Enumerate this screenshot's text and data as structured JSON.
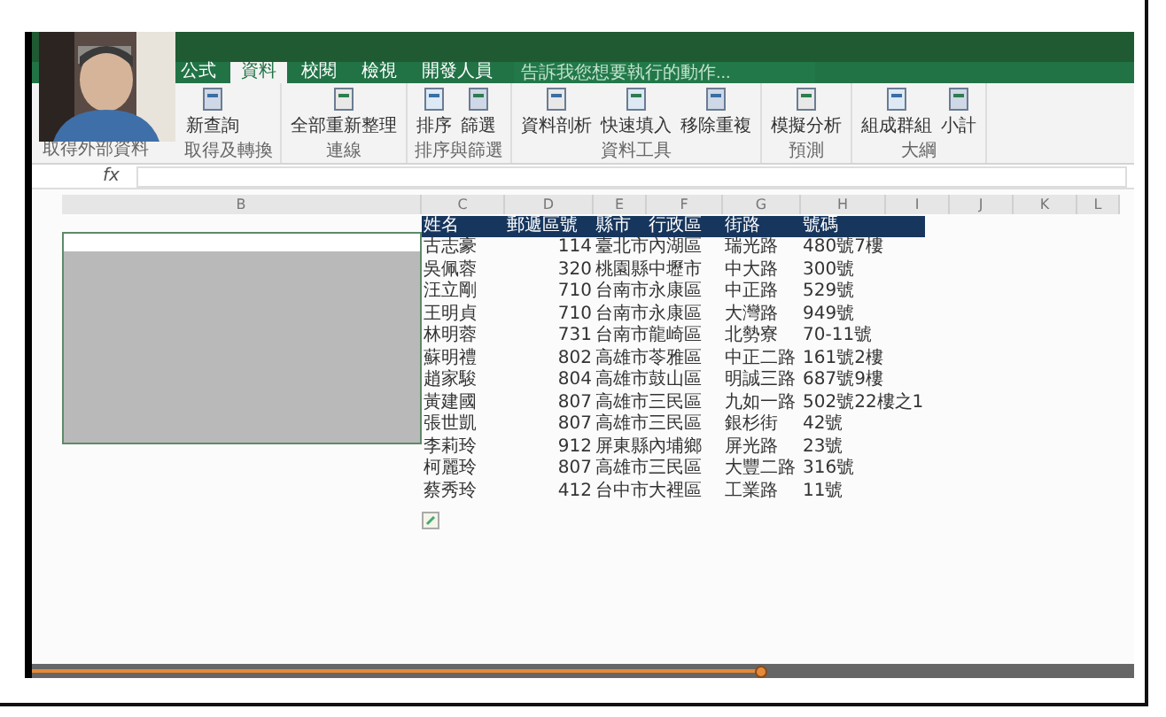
{
  "ribbon_tabs": [
    {
      "label": "公式",
      "selected": false
    },
    {
      "label": "資料",
      "selected": true
    },
    {
      "label": "校閱",
      "selected": false
    },
    {
      "label": "檢視",
      "selected": false
    },
    {
      "label": "開發人員",
      "selected": false
    }
  ],
  "tell_me": {
    "placeholder": "告訴我您想要執行的動作..."
  },
  "first_group": "取得外部資料",
  "ribbon_groups": [
    {
      "label": "取得及轉換",
      "buttons": [
        "新查詢"
      ]
    },
    {
      "label": "連線",
      "buttons": [
        "全部重新整理"
      ]
    },
    {
      "label": "排序與篩選",
      "buttons": [
        "排序",
        "篩選"
      ]
    },
    {
      "label": "資料工具",
      "buttons": [
        "資料剖析",
        "快速填入",
        "移除重複"
      ]
    },
    {
      "label": "預測",
      "buttons": [
        "模擬分析"
      ]
    },
    {
      "label": "大綱",
      "buttons": [
        "組成群組",
        "小計"
      ]
    }
  ],
  "formula_bar": {
    "function_label": "fx"
  },
  "column_letters": [
    "B",
    "C",
    "D",
    "E",
    "F",
    "G",
    "H",
    "I",
    "J",
    "K",
    "L"
  ],
  "table": {
    "columns": [
      "姓名",
      "郵遞區號",
      "縣市",
      "行政區",
      "街路",
      "號碼"
    ],
    "rows": [
      [
        "古志豪",
        "114",
        "臺北市",
        "內湖區",
        "瑞光路",
        "480號7樓"
      ],
      [
        "吳佩蓉",
        "320",
        "桃園縣",
        "中壢市",
        "中大路",
        "300號"
      ],
      [
        "汪立剛",
        "710",
        "台南市",
        "永康區",
        "中正路",
        "529號"
      ],
      [
        "王明貞",
        "710",
        "台南市",
        "永康區",
        "大灣路",
        "949號"
      ],
      [
        "林明蓉",
        "731",
        "台南市",
        "龍崎區",
        "北勢寮",
        "70-11號"
      ],
      [
        "蘇明禮",
        "802",
        "高雄市",
        "苓雅區",
        "中正二路",
        "161號2樓"
      ],
      [
        "趙家駿",
        "804",
        "高雄市",
        "鼓山區",
        "明誠三路",
        "687號9樓"
      ],
      [
        "黃建國",
        "807",
        "高雄市",
        "三民區",
        "九如一路",
        "502號22樓之1"
      ],
      [
        "張世凱",
        "807",
        "高雄市",
        "三民區",
        "銀杉街",
        "42號"
      ],
      [
        "李莉玲",
        "912",
        "屏東縣",
        "內埔鄉",
        "屏光路",
        "23號"
      ],
      [
        "柯麗玲",
        "807",
        "高雄市",
        "三民區",
        "大豐二路",
        "316號"
      ],
      [
        "蔡秀玲",
        "412",
        "台中市",
        "大裡區",
        "工業路",
        "11號"
      ]
    ]
  },
  "video": {
    "level": 0.66
  }
}
